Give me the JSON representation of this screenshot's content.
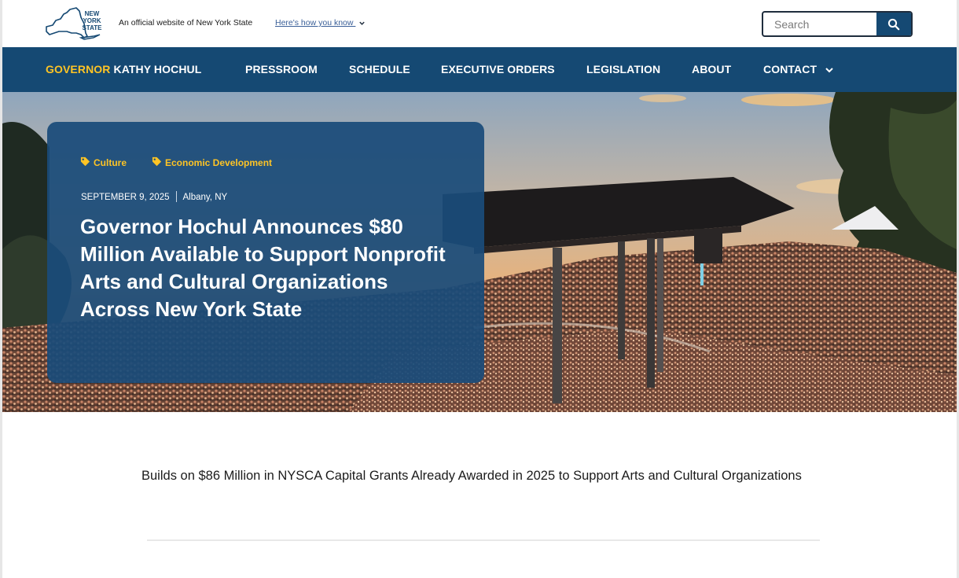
{
  "topbar": {
    "logo_lines": [
      "NEW",
      "YORK",
      "STATE"
    ],
    "official_text": "An official website of New York State",
    "how_you_know": "Here's how you know"
  },
  "search": {
    "placeholder": "Search",
    "value": ""
  },
  "nav": {
    "governor_prefix": "GOVERNOR",
    "governor_name": "KATHY HOCHUL",
    "items": [
      "PRESSROOM",
      "SCHEDULE",
      "EXECUTIVE ORDERS",
      "LEGISLATION",
      "ABOUT",
      "CONTACT"
    ]
  },
  "hero": {
    "tags": [
      "Culture",
      "Economic Development"
    ],
    "date": "SEPTEMBER 9, 2025",
    "location": "Albany, NY",
    "headline": "Governor Hochul Announces $80 Million Available to Support Nonprofit Arts and Cultural Organizations Across New York State"
  },
  "content": {
    "subheading": "Builds on $86 Million in NYSCA Capital Grants Already Awarded in 2025 to Support Arts and Cultural Organizations"
  },
  "colors": {
    "nav_blue": "#154973",
    "accent_gold": "#fec425",
    "card_blue": "#1a4b7a"
  }
}
